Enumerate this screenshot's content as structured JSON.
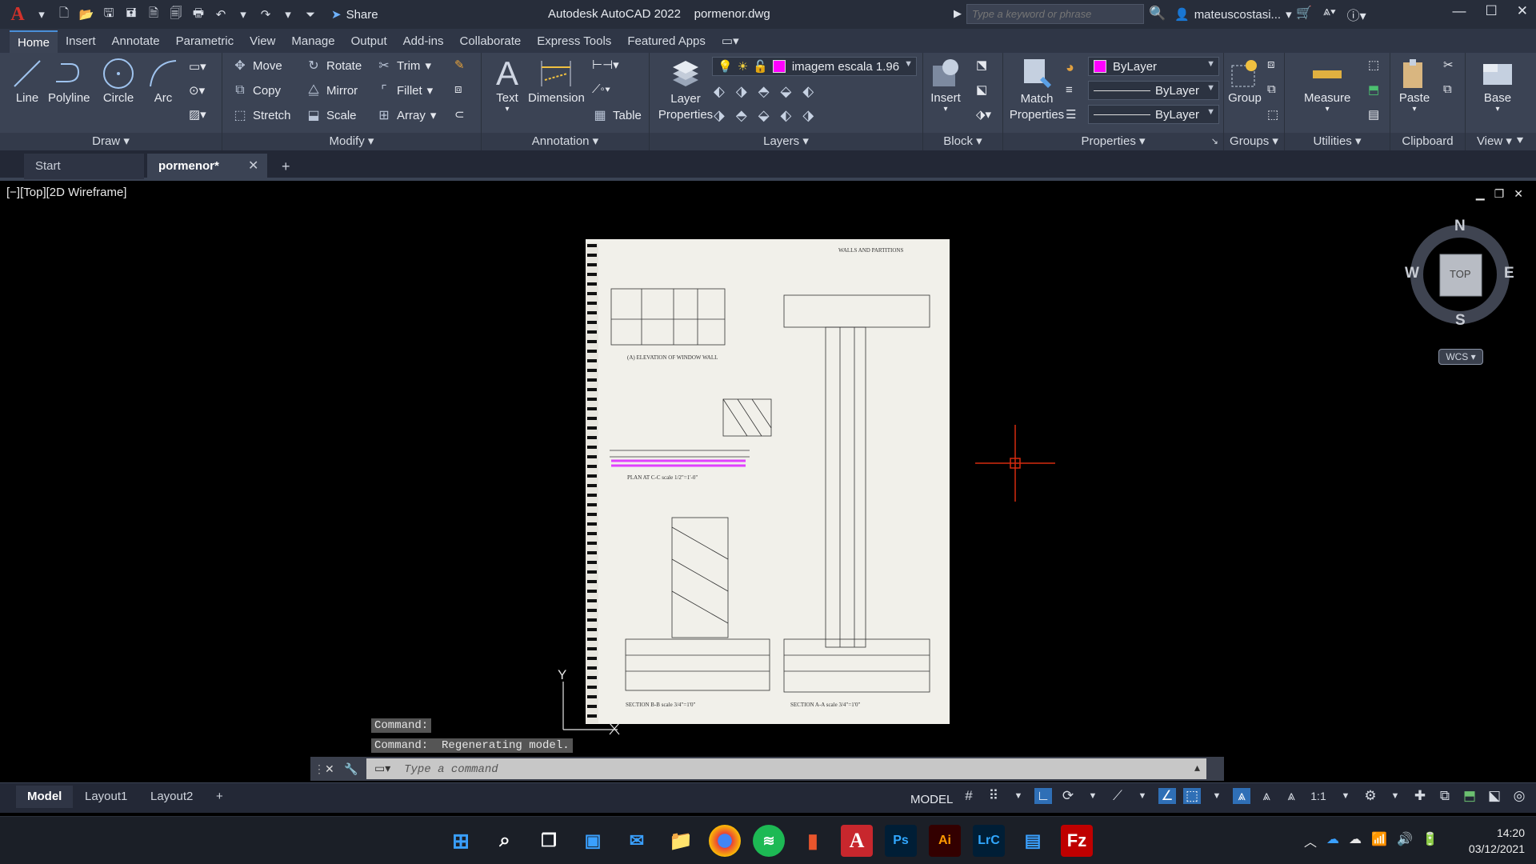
{
  "app": {
    "logo": "A",
    "title": "Autodesk AutoCAD 2022",
    "file": "pormenor.dwg",
    "share_label": "Share",
    "search_placeholder": "Type a keyword or phrase",
    "user": "mateuscostasi..."
  },
  "ribbon_tabs": [
    "Home",
    "Insert",
    "Annotate",
    "Parametric",
    "View",
    "Manage",
    "Output",
    "Add-ins",
    "Collaborate",
    "Express Tools",
    "Featured Apps"
  ],
  "panels": {
    "draw": {
      "label": "Draw",
      "line": "Line",
      "polyline": "Polyline",
      "circle": "Circle",
      "arc": "Arc"
    },
    "modify": {
      "label": "Modify",
      "move": "Move",
      "rotate": "Rotate",
      "trim": "Trim",
      "copy": "Copy",
      "mirror": "Mirror",
      "fillet": "Fillet",
      "stretch": "Stretch",
      "scale": "Scale",
      "array": "Array"
    },
    "annotation": {
      "label": "Annotation",
      "text": "Text",
      "dimension": "Dimension",
      "table": "Table"
    },
    "layers": {
      "label": "Layers",
      "layer_properties": "Layer Properties",
      "current_layer": "imagem escala 1.96"
    },
    "block": {
      "label": "Block",
      "insert": "Insert"
    },
    "properties": {
      "label": "Properties",
      "match": "Match Properties",
      "color": "ByLayer",
      "linetype": "ByLayer",
      "lineweight": "ByLayer"
    },
    "groups": {
      "label": "Groups",
      "group": "Group"
    },
    "utilities": {
      "label": "Utilities",
      "measure": "Measure"
    },
    "clipboard": {
      "label": "Clipboard",
      "paste": "Paste"
    },
    "view": {
      "label": "View",
      "base": "Base"
    }
  },
  "doc_tabs": {
    "start": "Start",
    "active": "pormenor*"
  },
  "viewport": {
    "label": "[−][Top][2D Wireframe]"
  },
  "viewcube": {
    "n": "N",
    "s": "S",
    "e": "E",
    "w": "W",
    "face": "TOP",
    "wcs": "WCS"
  },
  "ucs": {
    "y": "Y"
  },
  "command": {
    "history": [
      "Command:",
      "Command:  Regenerating model."
    ],
    "placeholder": "Type a command"
  },
  "drawing": {
    "heading": "WALLS AND PARTITIONS",
    "label_elevation": "(A) ELEVATION OF WINDOW WALL",
    "label_plan": "PLAN AT C-C  scale 1/2\"=1'-0\"",
    "label_section_b": "SECTION B-B  scale 3/4\"=1'0\"",
    "label_section_a": "SECTION A-A scale 3/4\"=1'0\""
  },
  "layout_tabs": [
    "Model",
    "Layout1",
    "Layout2"
  ],
  "status": {
    "model": "MODEL",
    "scale": "1:1"
  },
  "clock": {
    "time": "14:20",
    "date": "03/12/2021"
  },
  "colors": {
    "accent": "#2f6fb6",
    "layer": "#ff00ff",
    "cursor": "#d62a0f",
    "highlight": "#e040ff"
  }
}
